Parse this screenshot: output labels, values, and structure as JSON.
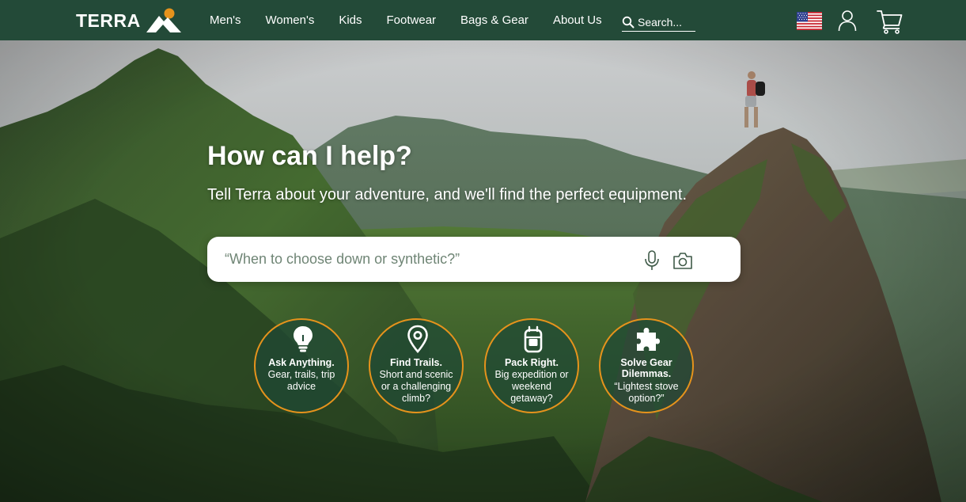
{
  "brand": {
    "name": "TERRA"
  },
  "nav": {
    "links": [
      "Men's",
      "Women's",
      "Kids",
      "Footwear",
      "Bags & Gear",
      "About Us"
    ],
    "search_placeholder": "Search...",
    "icons": [
      "us-flag-icon",
      "user-icon",
      "cart-icon"
    ]
  },
  "hero": {
    "title": "How can I help?",
    "subtitle": "Tell Terra about your adventure, and we'll find the perfect equipment.",
    "ask_placeholder": "“When to choose down or synthetic?”",
    "icons": [
      "microphone-icon",
      "camera-icon"
    ]
  },
  "suggestions": [
    {
      "title": "Ask Anything.",
      "text": "Gear, trails, trip advice",
      "icon": "lightbulb-icon"
    },
    {
      "title": "Find Trails.",
      "text": "Short and scenic or a challenging climb?",
      "icon": "map-pin-icon"
    },
    {
      "title": "Pack Right.",
      "text": "Big expedition or weekend getaway?",
      "icon": "backpack-icon"
    },
    {
      "title": "Solve Gear Dilemmas.",
      "text": "“Lightest stove option?”",
      "icon": "puzzle-icon"
    }
  ],
  "colors": {
    "nav_bg": "#234a38",
    "accent": "#e6931c",
    "bubble_bg": "#1e4834"
  }
}
